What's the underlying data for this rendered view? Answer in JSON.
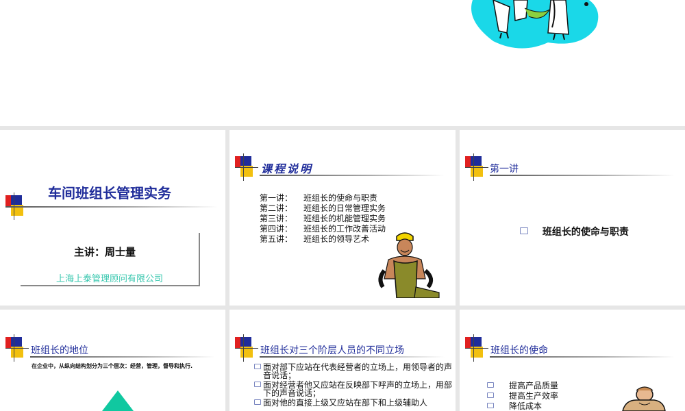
{
  "slides": [
    {
      "main_title": "车间班组长管理实务",
      "speaker": "主讲：周士量",
      "company": "上海上泰管理顾问有限公司"
    },
    {
      "title": "课程说明",
      "lectures": [
        {
          "no": "第一讲：",
          "topic": "班组长的使命与职责"
        },
        {
          "no": "第二讲：",
          "topic": "班组长的日常管理实务"
        },
        {
          "no": "第三讲：",
          "topic": "班组长的机能管理实务"
        },
        {
          "no": "第四讲：",
          "topic": "班组长的工作改善活动"
        },
        {
          "no": "第五讲：",
          "topic": "班组长的领导艺术"
        }
      ]
    },
    {
      "title": "第一讲",
      "item": "班组长的使命与职责"
    },
    {
      "title": "班组长的地位",
      "text": "在企业中，从纵向结构划分为三个层次：经营，管理，督导和执行."
    },
    {
      "title": "班组长对三个阶层人员的不同立场",
      "items": [
        "面对部下应站在代表经营者的立场上，用领导者的声音说话；",
        "面对经营者他又应站在反映部下呼声的立场上，用部下的声音说话；",
        "面对他的直接上级又应站在部下和上级辅助人"
      ]
    },
    {
      "title": "班组长的使命",
      "items": [
        "提高产品质量",
        "提高生产效率",
        "降低成本"
      ]
    }
  ],
  "colors": {
    "title_navy": "#1f2c9a",
    "company_teal": "#3cc8b0",
    "logo_red": "#e02020",
    "logo_yellow": "#f2c00f",
    "triangle_teal": "#10c8a0",
    "clipart_cyan": "#1ad8e8"
  },
  "icons": [
    "slide-logo-icon",
    "book-bullet-icon",
    "people-clipart",
    "worker-clipart",
    "pyramid-triangle",
    "figure-clipart"
  ]
}
